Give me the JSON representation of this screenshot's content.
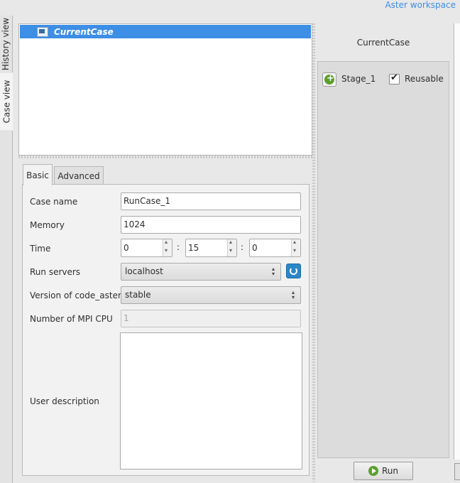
{
  "header": {
    "workspace_label": "Aster workspace"
  },
  "side_tabs": {
    "history": "History view",
    "case": "Case view"
  },
  "tree": {
    "current_case": "CurrentCase"
  },
  "tabs": {
    "basic": "Basic",
    "advanced": "Advanced"
  },
  "form": {
    "case_name_label": "Case name",
    "case_name_value": "RunCase_1",
    "memory_label": "Memory",
    "memory_value": "1024",
    "time_label": "Time",
    "time_hours": "0",
    "time_minutes": "15",
    "time_seconds": "0",
    "time_sep": ":",
    "run_servers_label": "Run servers",
    "run_servers_value": "localhost",
    "version_label": "Version of code_aster",
    "version_value": "stable",
    "mpi_label": "Number of MPI CPU",
    "mpi_value": "1",
    "description_label": "User description",
    "description_value": ""
  },
  "stages": {
    "header": "CurrentCase",
    "items": [
      {
        "name": "Stage_1",
        "reusable_label": "Reusable",
        "reusable": true
      }
    ]
  },
  "actions": {
    "run_label": "Run"
  },
  "icons": {
    "case": "case-icon",
    "refresh": "refresh-icon",
    "add": "add-stage-icon",
    "run": "run-icon"
  },
  "colors": {
    "accent": "#3d8ee5",
    "refresh": "#2c87c7",
    "green": "#5aa02c"
  }
}
